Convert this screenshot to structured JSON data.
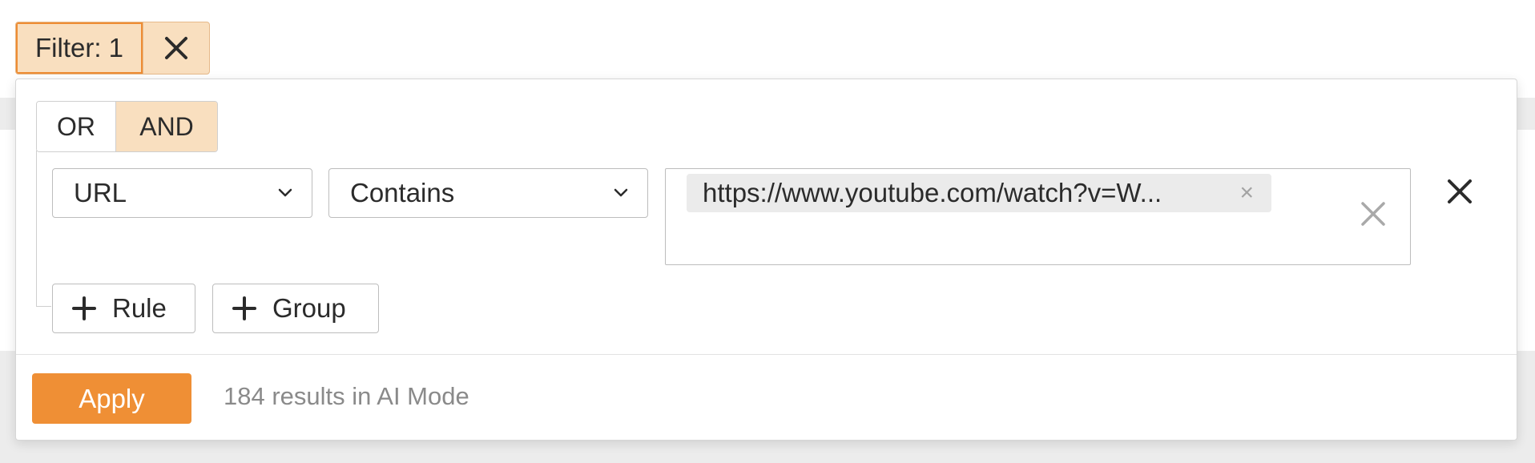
{
  "filter_chip": {
    "label": "Filter: 1",
    "clear_icon": "close-icon"
  },
  "logic": {
    "options": [
      "OR",
      "AND"
    ],
    "selected": "AND"
  },
  "rule": {
    "field": "URL",
    "operator": "Contains",
    "value_tag": "https://www.youtube.com/watch?v=W...",
    "tag_remove": "×",
    "icons": {
      "field_dropdown": "chevron-down-icon",
      "operator_dropdown": "chevron-down-icon",
      "clear_values": "close-icon",
      "remove_rule": "close-icon"
    }
  },
  "actions": {
    "add_rule": "Rule",
    "add_group": "Group"
  },
  "footer": {
    "apply_label": "Apply",
    "result_text": "184 results in AI Mode"
  },
  "colors": {
    "accent": "#ef8f35",
    "selected_fill": "#f9dfbf",
    "muted_text": "#8a8a8a"
  }
}
